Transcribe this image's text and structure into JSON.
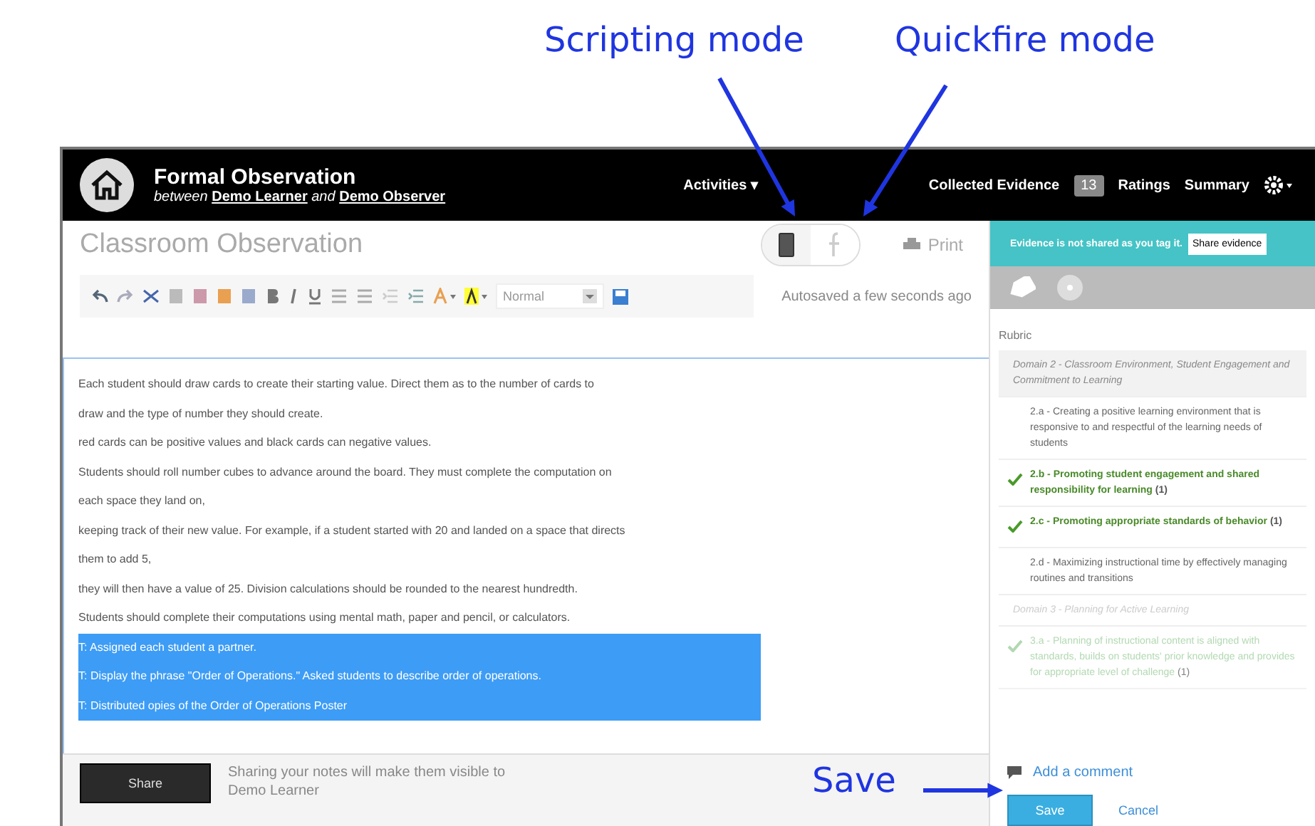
{
  "annotations": [
    {
      "text": "Scripting mode"
    },
    {
      "text": "Quickfire mode"
    },
    {
      "text": "Save"
    }
  ],
  "header": {
    "title": "Formal Observation",
    "subtitle": "*between* **Demo Learner** *and* **Demo Observer**",
    "nav": [
      {
        "label": "Activities ▾",
        "kind": "link"
      },
      {
        "label": "Collected Evidence",
        "kind": "badge",
        "badge": "13"
      },
      {
        "label": "Ratings",
        "kind": "link"
      },
      {
        "label": "Summary",
        "kind": "link"
      }
    ]
  },
  "editor": {
    "title": "Classroom Observation",
    "modes": [
      {
        "kind": "scripting",
        "selected": true
      },
      {
        "kind": "quickfire",
        "selected": false
      }
    ],
    "print": "Print",
    "format": "Normal",
    "autosave": "Autosaved a few seconds ago",
    "lines": [
      {
        "text": "Each student should draw cards to create their starting value. Direct them as to the number of cards to",
        "selected": false
      },
      {
        "text": "draw and the type of number they should create.",
        "selected": false
      },
      {
        "text": "red cards can be positive values and black cards can negative values.",
        "selected": false
      },
      {
        "text": "Students should roll number cubes to advance around the board. They must complete the computation on",
        "selected": false
      },
      {
        "text": "each space they land on,",
        "selected": false
      },
      {
        "text": "keeping track of their new value. For example, if a student started with 20 and landed on a space that directs",
        "selected": false
      },
      {
        "text": "them to add 5,",
        "selected": false
      },
      {
        "text": "they will then have a value of 25. Division calculations should be rounded to the nearest hundredth.",
        "selected": false
      },
      {
        "text": "Students should complete their computations using mental math, paper and pencil, or calculators.",
        "selected": false
      },
      {
        "text": "T: Assigned each student a partner.",
        "selected": true
      },
      {
        "text": "T: Display the phrase \"Order of Operations.\" Asked students to describe order of operations.",
        "selected": true
      },
      {
        "text": "T: Distributed opies of the Order of Operations Poster",
        "selected": true
      }
    ],
    "share_button": "Share",
    "share_note": [
      "Sharing your notes will make them visible to",
      "Demo Learner"
    ]
  },
  "evidence": {
    "banner": "Evidence is not shared as you tag it.",
    "share_button": "Share evidence",
    "heading": "Rubric",
    "items": [
      {
        "kind": "domain",
        "text": "Domain 2 - Classroom Environment, Student Engagement and Commitment to Learning",
        "dimmed": false
      },
      {
        "kind": "component",
        "text": "2.a - Creating a positive learning environment that is responsive to and respectful of the learning needs of students",
        "checked": false,
        "dimmed": false
      },
      {
        "kind": "component",
        "text": "2.b - Promoting student engagement and shared responsibility for learning",
        "count": "(1)",
        "checked": true,
        "dimmed": false
      },
      {
        "kind": "component",
        "text": "2.c - Promoting appropriate standards of behavior",
        "count": "(1)",
        "checked": true,
        "dimmed": false
      },
      {
        "kind": "component",
        "text": "2.d - Maximizing instructional time by effectively managing routines and transitions",
        "checked": false,
        "dimmed": false
      },
      {
        "kind": "domain",
        "text": "Domain 3 - Planning for Active Learning",
        "dimmed": true
      },
      {
        "kind": "component",
        "text": "3.a - Planning of instructional content is aligned with standards, builds on students' prior knowledge and provides for appropriate level of challenge",
        "count": "(1)",
        "checked": true,
        "dimmed": true
      }
    ],
    "comment_link": "Add a comment",
    "save": "Save",
    "cancel": "Cancel"
  }
}
